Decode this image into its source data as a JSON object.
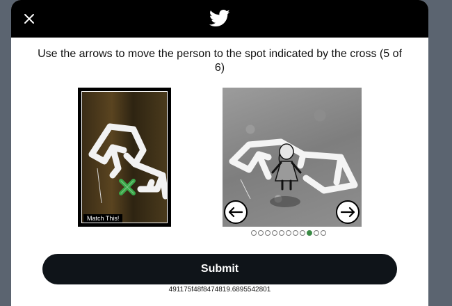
{
  "header": {
    "close_icon": "close-icon",
    "logo_icon": "twitter-bird-icon"
  },
  "instruction": "Use the arrows to move the person to the spot indicated by the cross (5 of 6)",
  "target": {
    "label": "Match This!"
  },
  "scene": {
    "left_arrow": "left-arrow-icon",
    "right_arrow": "right-arrow-icon"
  },
  "pager": {
    "total": 11,
    "active_index": 8
  },
  "submit": {
    "label": "Submit"
  },
  "session_id": "491175f48f8474819.6895542801",
  "colors": {
    "header_bg": "#000000",
    "submit_bg": "#0f1419",
    "active_dot": "#3a8a45",
    "cross": "#3aa84a"
  }
}
